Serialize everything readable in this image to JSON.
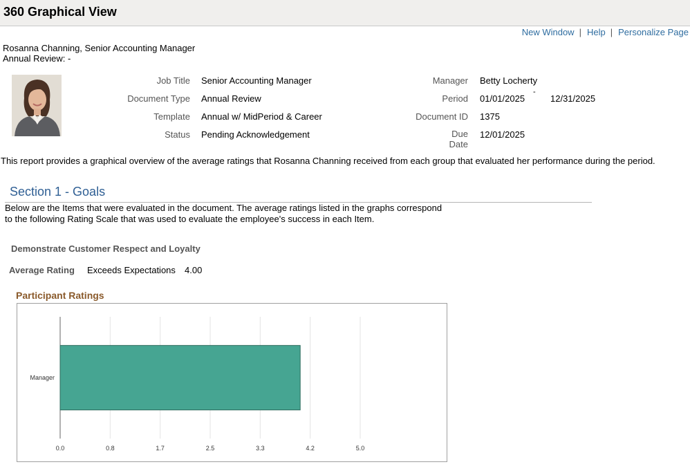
{
  "page": {
    "title": "360 Graphical View",
    "links": {
      "new_window": "New Window",
      "help": "Help",
      "personalize": "Personalize Page",
      "sep": "|"
    }
  },
  "employee": {
    "name_line": "Rosanna Channing, Senior Accounting Manager",
    "review_line": "Annual Review: -"
  },
  "details": {
    "job_title_label": "Job Title",
    "job_title": "Senior Accounting Manager",
    "doc_type_label": "Document Type",
    "doc_type": "Annual Review",
    "template_label": "Template",
    "template": "Annual w/ MidPeriod & Career",
    "status_label": "Status",
    "status": "Pending Acknowledgement",
    "manager_label": "Manager",
    "manager": "Betty Locherty",
    "period_label": "Period",
    "period_start": "01/01/2025",
    "period_dash": "-",
    "period_end": "12/31/2025",
    "doc_id_label": "Document ID",
    "doc_id": "1375",
    "due_label_1": "Due",
    "due_label_2": "Date",
    "due_date": "12/01/2025"
  },
  "report_desc": "This report provides a graphical overview of the average ratings that Rosanna Channing received from each group that evaluated her performance during the period.",
  "section": {
    "title": "Section 1 - Goals",
    "desc_line1": "Below are the Items that were evaluated in the document. The average ratings listed in the graphs correspond",
    "desc_line2": "to the following Rating Scale that was used to evaluate the employee's success in each Item."
  },
  "item": {
    "title": "Demonstrate Customer Respect and Loyalty",
    "avg_label": "Average Rating",
    "avg_text": "Exceeds Expectations",
    "avg_value": "4.00"
  },
  "chart_title": "Participant Ratings",
  "chart_data": {
    "type": "bar",
    "orientation": "horizontal",
    "categories": [
      "Manager"
    ],
    "values": [
      4.0
    ],
    "xlim": [
      0,
      5.0
    ],
    "xticks": [
      "0.0",
      "0.8",
      "1.7",
      "2.5",
      "3.3",
      "4.2",
      "5.0"
    ],
    "bar_color": "#46a592",
    "grid": true
  }
}
